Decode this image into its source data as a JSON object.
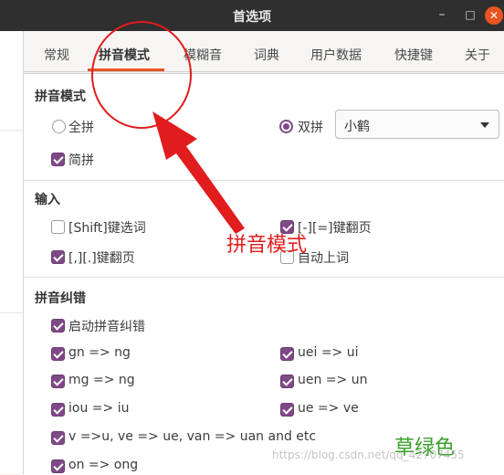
{
  "window": {
    "title": "首选项",
    "minimize": "–",
    "maximize": "□",
    "close": "✕"
  },
  "tabs": [
    {
      "label": "常规"
    },
    {
      "label": "拼音模式",
      "active": true
    },
    {
      "label": "模糊音"
    },
    {
      "label": "词典"
    },
    {
      "label": "用户数据"
    },
    {
      "label": "快捷键"
    },
    {
      "label": "关于"
    }
  ],
  "pinyin_mode": {
    "title": "拼音模式",
    "full_label": "全拼",
    "full_selected": false,
    "double_label": "双拼",
    "double_selected": true,
    "scheme_value": "小鹤",
    "simple_label": "简拼",
    "simple_checked": true
  },
  "input": {
    "title": "输入",
    "shift_select_label": "[Shift]键选词",
    "shift_select_checked": false,
    "minus_equal_label": "[-][=]键翻页",
    "minus_equal_checked": true,
    "comma_period_label": "[,][.]键翻页",
    "comma_period_checked": true,
    "auto_commit_label": "自动上词",
    "auto_commit_checked": false
  },
  "correction": {
    "title": "拼音纠错",
    "enable_label": "启动拼音纠错",
    "enable_checked": true,
    "items": [
      {
        "label": "gn => ng",
        "checked": true
      },
      {
        "label": "uei => ui",
        "checked": true
      },
      {
        "label": "mg => ng",
        "checked": true
      },
      {
        "label": "uen => un",
        "checked": true
      },
      {
        "label": "iou => iu",
        "checked": true
      },
      {
        "label": "ue => ve",
        "checked": true
      },
      {
        "label": "v =>u, ve => ue, van => uan and etc",
        "checked": true
      },
      {
        "label": "on => ong",
        "checked": true
      }
    ]
  },
  "annotations": {
    "red_label": "拼音模式",
    "green_label": "草绿色",
    "red_color": "#e11d1d",
    "green_color": "#3aa02a",
    "watermark": "https://blog.csdn.net/qq_42707455"
  },
  "colors": {
    "accent": "#e95420",
    "check": "#7e4a86",
    "titlebar": "#2f2f2f"
  }
}
